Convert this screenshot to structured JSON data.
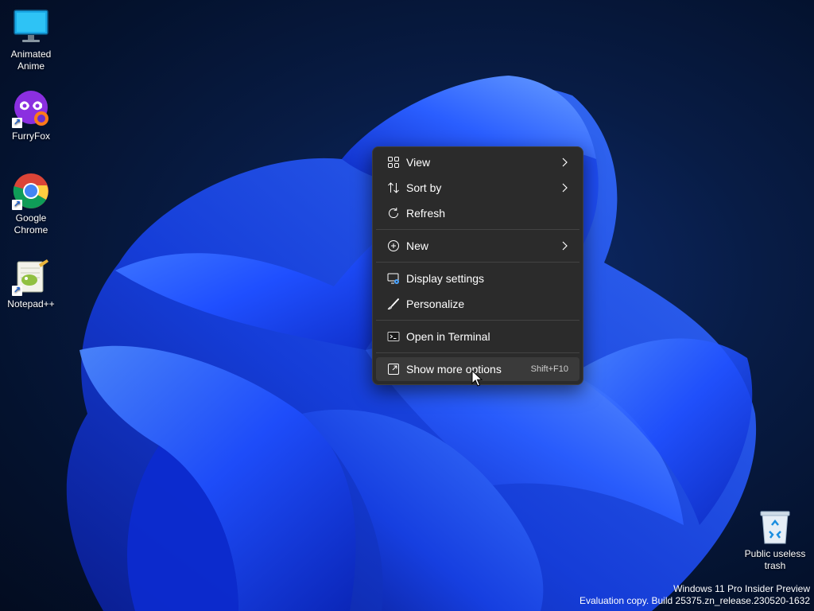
{
  "desktop_icons": [
    {
      "label": "Animated\nAnime",
      "icon": "monitor-icon"
    },
    {
      "label": "FurryFox",
      "icon": "furryfox-icon"
    },
    {
      "label": "Google\nChrome",
      "icon": "chrome-icon"
    },
    {
      "label": "Notepad++",
      "icon": "notepadpp-icon"
    },
    {
      "label": "Public useless\ntrash",
      "icon": "recycle-bin-icon"
    }
  ],
  "context_menu": {
    "items": [
      {
        "label": "View",
        "icon": "grid-icon",
        "submenu": true
      },
      {
        "label": "Sort by",
        "icon": "sort-icon",
        "submenu": true
      },
      {
        "label": "Refresh",
        "icon": "refresh-icon",
        "submenu": false
      },
      {
        "label": "New",
        "icon": "plus-circle-icon",
        "submenu": true
      },
      {
        "label": "Display settings",
        "icon": "display-settings-icon",
        "submenu": false
      },
      {
        "label": "Personalize",
        "icon": "brush-icon",
        "submenu": false
      },
      {
        "label": "Open in Terminal",
        "icon": "terminal-icon",
        "submenu": false
      },
      {
        "label": "Show more options",
        "icon": "expand-icon",
        "shortcut": "Shift+F10",
        "hovered": true
      }
    ]
  },
  "watermark": {
    "line1": "Windows 11 Pro Insider Preview",
    "line2": "Evaluation copy. Build 25375.zn_release.230520-1632"
  },
  "colors": {
    "menu_bg": "#2b2b2b",
    "menu_hover": "#3a3a3a",
    "accent_blue": "#1f4fff"
  }
}
